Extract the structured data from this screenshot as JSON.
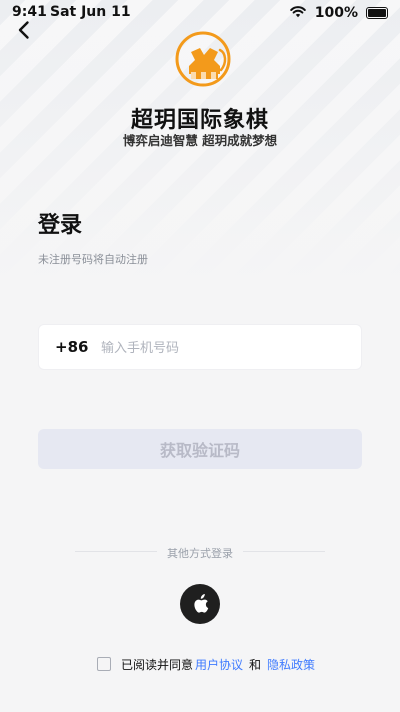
{
  "status_bar": {
    "time": "9:41",
    "date": "Sat Jun 11",
    "battery": "100%"
  },
  "brand": {
    "title": "超玥国际象棋",
    "subtitle": "博弈启迪智慧 超玥成就梦想",
    "accent_color": "#f39a1b"
  },
  "login": {
    "title": "登录",
    "hint": "未注册号码将自动注册",
    "country_code": "+86",
    "phone_placeholder": "输入手机号码",
    "get_code_button": "获取验证码"
  },
  "alt_login": {
    "label": "其他方式登录",
    "apple_icon": "apple-icon"
  },
  "terms": {
    "prefix": "已阅读并同意",
    "user_agreement": "用户协议",
    "and": "和",
    "privacy_policy": "隐私政策",
    "link_color": "#3f7bff"
  }
}
